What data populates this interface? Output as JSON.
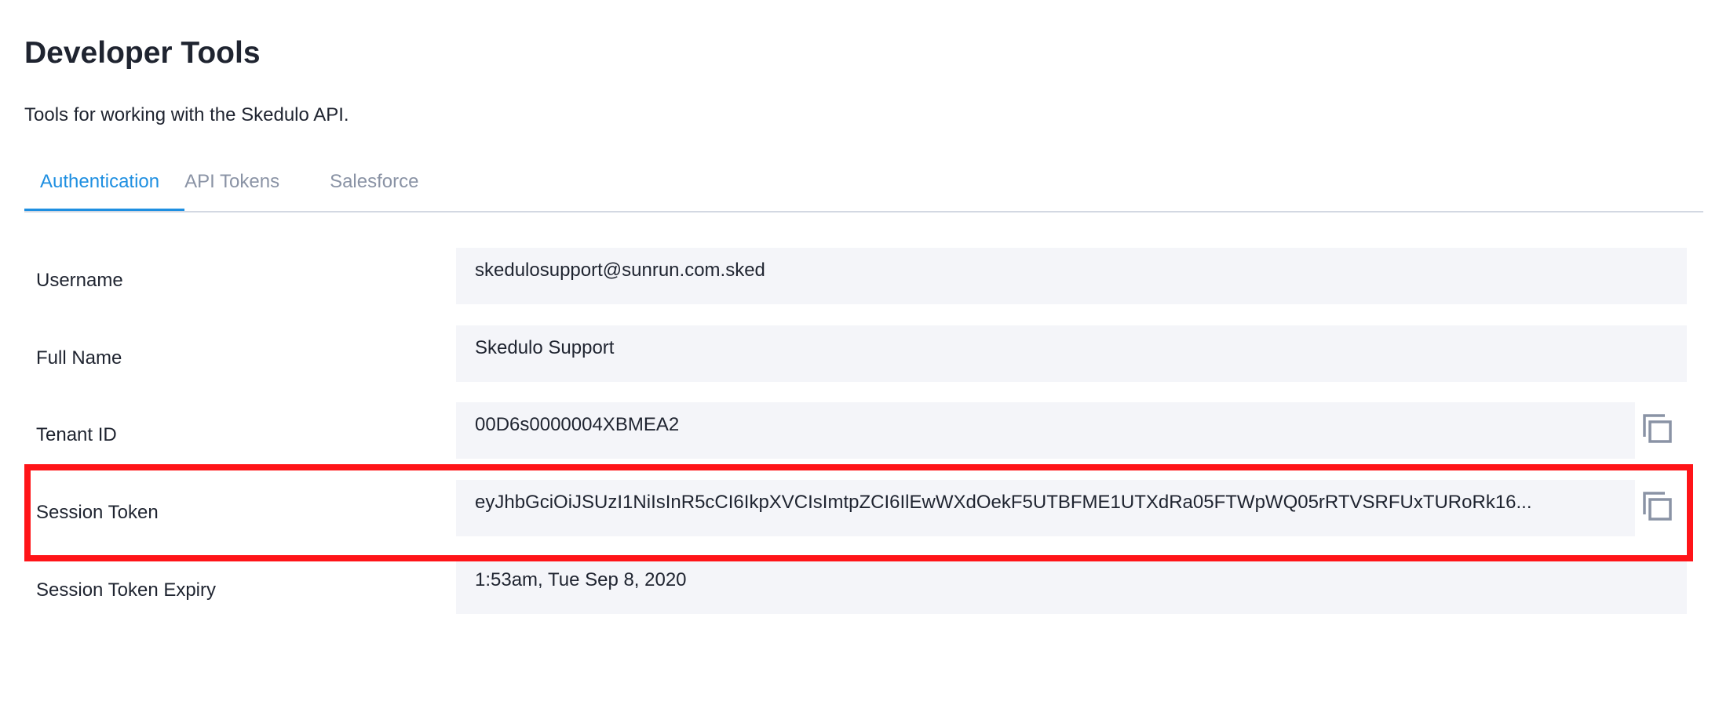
{
  "header": {
    "title": "Developer Tools",
    "subtitle": "Tools for working with the Skedulo API."
  },
  "tabs": [
    {
      "label": "Authentication",
      "active": true
    },
    {
      "label": "API Tokens",
      "active": false
    },
    {
      "label": "Salesforce",
      "active": false
    }
  ],
  "fields": {
    "username": {
      "label": "Username",
      "value": "skedulosupport@sunrun.com.sked"
    },
    "full_name": {
      "label": "Full Name",
      "value": "Skedulo Support"
    },
    "tenant_id": {
      "label": "Tenant ID",
      "value": "00D6s0000004XBMEA2",
      "copy_icon": "copy-icon"
    },
    "session_token": {
      "label": "Session Token",
      "value": "eyJhbGciOiJSUzI1NiIsInR5cCI6IkpXVCIsImtpZCI6IlEwWXdOekF5UTBFME1UTXdRa05FTWpWQ05rRTVSRFUxTURoRk16...",
      "copy_icon": "copy-icon"
    },
    "session_token_expiry": {
      "label": "Session Token Expiry",
      "value": "1:53am, Tue Sep 8, 2020"
    }
  },
  "colors": {
    "accent": "#1e8fe1",
    "highlight": "#ff1418",
    "field_bg": "#f4f5f9"
  }
}
